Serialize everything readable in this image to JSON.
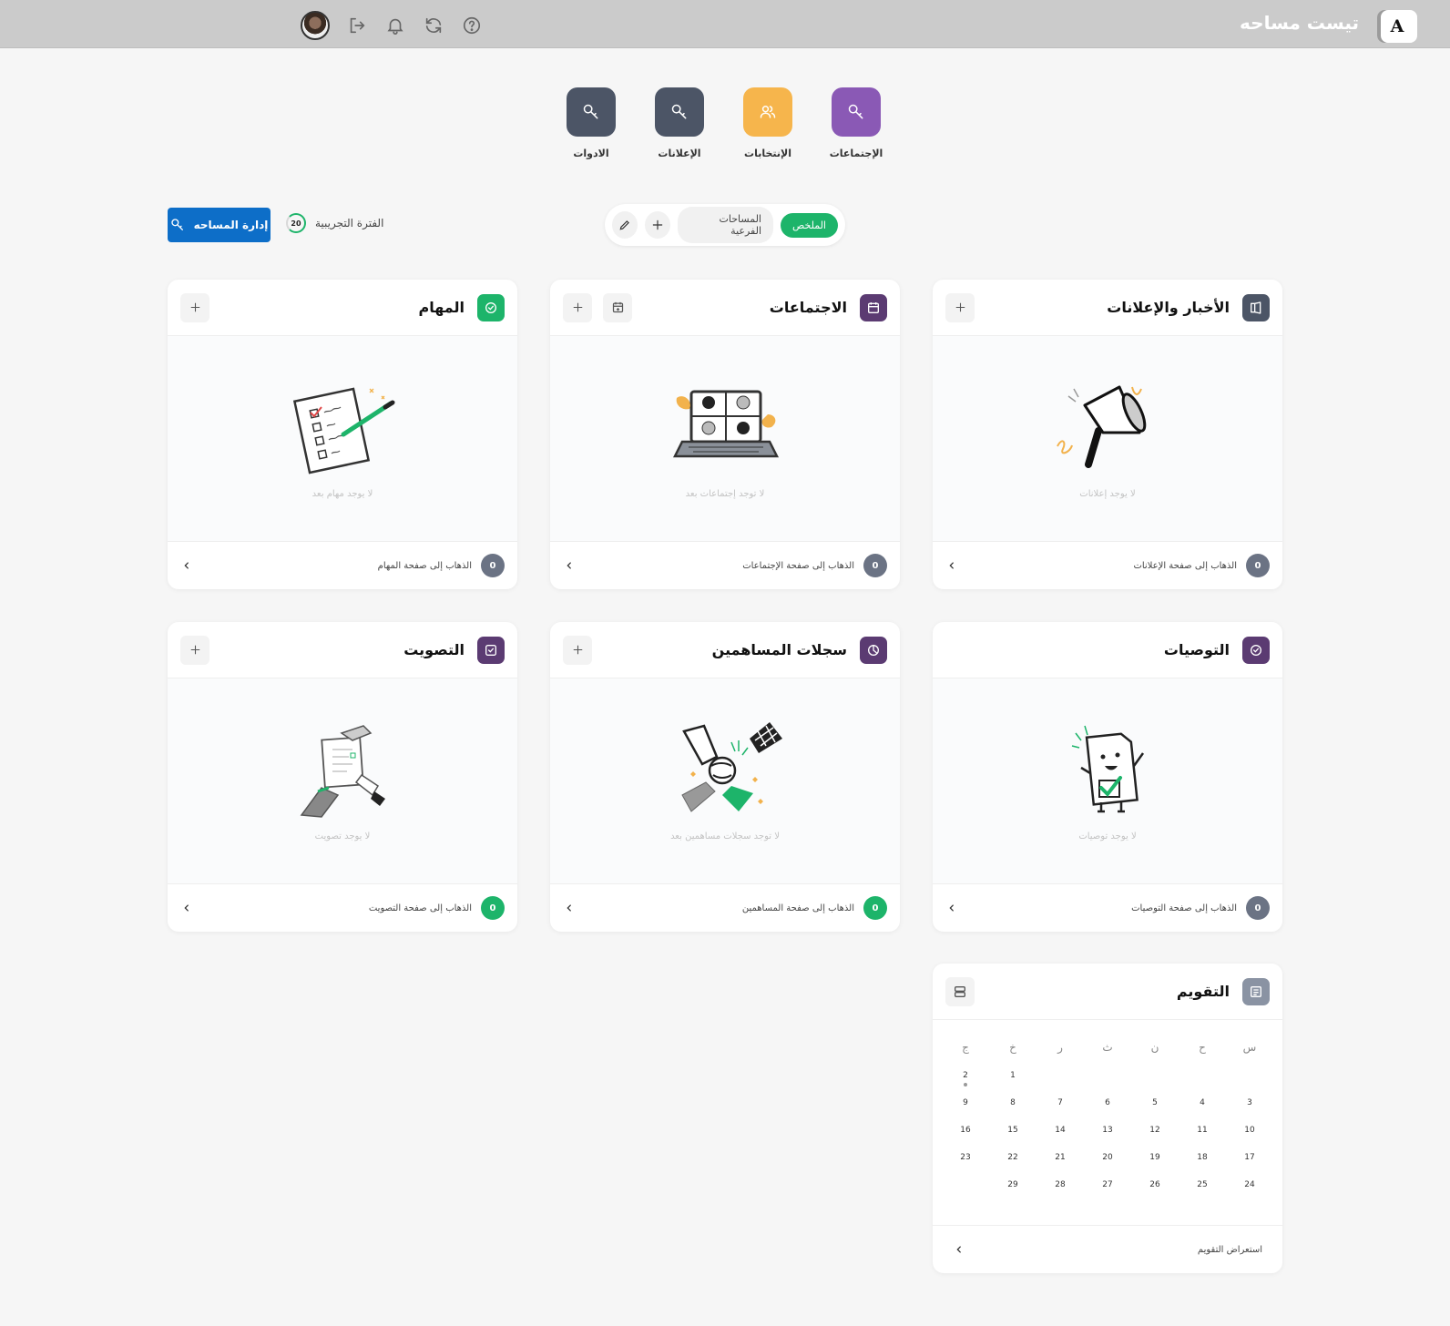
{
  "topbar": {
    "space_title": "تيست مساحه",
    "logo_text": "A",
    "icons": [
      "help-icon",
      "refresh-icon",
      "bell-icon",
      "logout-icon",
      "avatar"
    ]
  },
  "apps": [
    {
      "label": "الإجتماعات",
      "color": "#8a59b5",
      "icon": "key-icon"
    },
    {
      "label": "الإنتخابات",
      "color": "#f6b54c",
      "icon": "users-icon"
    },
    {
      "label": "الإعلانات",
      "color": "#4c5566",
      "icon": "key-icon"
    },
    {
      "label": "الادوات",
      "color": "#4c5566",
      "icon": "key-icon"
    }
  ],
  "filter": {
    "summary_tab": "الملخص",
    "subspaces_tab": "المساحات الفرعية"
  },
  "trial": {
    "label": "الفترة التجريبية",
    "days": "20"
  },
  "manage_button": "إدارة المساحه",
  "cards": {
    "news": {
      "title": "الأخبار والإعلانات",
      "empty": "لا يوجد إعلانات",
      "link": "الذهاب إلى صفحة الإعلانات",
      "count": "0"
    },
    "meetings": {
      "title": "الاجتماعات",
      "empty": "لا توجد إجتماعات بعد",
      "link": "الذهاب إلى صفحة الإجتماعات",
      "count": "0"
    },
    "tasks": {
      "title": "المهام",
      "empty": "لا يوجد مهام بعد",
      "link": "الذهاب إلى صفحة المهام",
      "count": "0"
    },
    "recommendations": {
      "title": "التوصيات",
      "empty": "لا يوجد توصيات",
      "link": "الذهاب إلى صفحة التوصيات",
      "count": "0"
    },
    "shareholders": {
      "title": "سجلات المساهمين",
      "empty": "لا توجد سجلات مساهمين بعد",
      "link": "الذهاب إلى صفحة المساهمين",
      "count": "0"
    },
    "voting": {
      "title": "التصويت",
      "empty": "لا يوجد تصويت",
      "link": "الذهاب إلى صفحة التصويت",
      "count": "0"
    }
  },
  "calendar": {
    "title": "التقويم",
    "weekdays": [
      "س",
      "ح",
      "ن",
      "ث",
      "ر",
      "خ",
      "ج"
    ],
    "weeks": [
      [
        "",
        "",
        "",
        "",
        "",
        "1",
        "2"
      ],
      [
        "3",
        "4",
        "5",
        "6",
        "7",
        "8",
        "9"
      ],
      [
        "10",
        "11",
        "12",
        "13",
        "14",
        "15",
        "16"
      ],
      [
        "17",
        "18",
        "19",
        "20",
        "21",
        "22",
        "23"
      ],
      [
        "24",
        "25",
        "26",
        "27",
        "28",
        "29",
        ""
      ]
    ],
    "marked_day": "2",
    "footer_link": "استعراض التقويم"
  },
  "colors": {
    "accent_green": "#1db46a",
    "primary_blue": "#0d6ec8",
    "purple": "#5b3b72",
    "count_gray": "#6b7384"
  }
}
